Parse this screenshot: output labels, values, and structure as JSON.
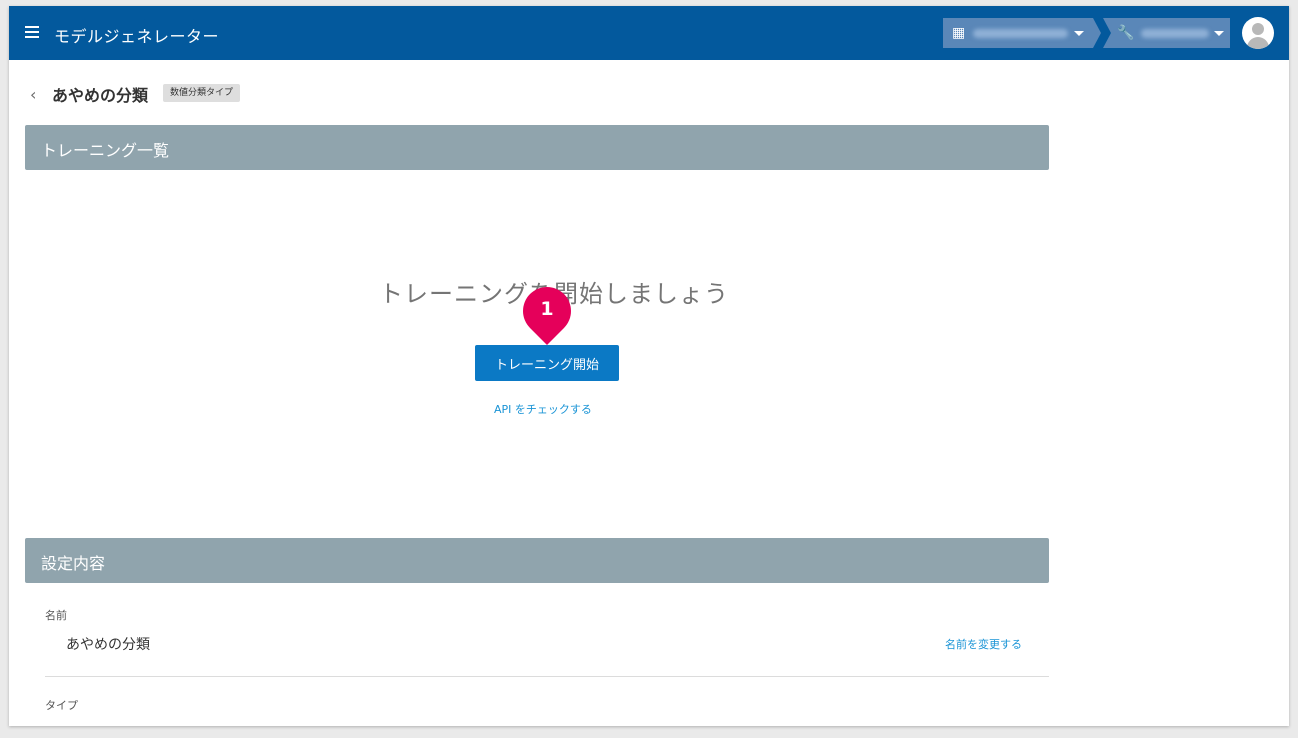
{
  "app": {
    "title": "モデルジェネレーター"
  },
  "header": {
    "org_selector": {
      "icon": "building-icon"
    },
    "tool_selector": {
      "icon": "wrench-icon"
    }
  },
  "page": {
    "title": "あやめの分類",
    "type_badge": "数値分類タイプ"
  },
  "training_section": {
    "header": "トレーニング一覧",
    "empty_message": "トレーニングを開始しましょう",
    "start_button": "トレーニング開始",
    "api_link": "API をチェックする",
    "marker_number": "1"
  },
  "settings_section": {
    "header": "設定内容",
    "name_label": "名前",
    "name_value": "あやめの分類",
    "rename_link": "名前を変更する",
    "type_label": "タイプ"
  },
  "colors": {
    "appbar": "#03599d",
    "section_header": "#90a4ad",
    "primary_button": "#0b79c5",
    "link": "#1a94d6",
    "marker": "#e5005a"
  }
}
